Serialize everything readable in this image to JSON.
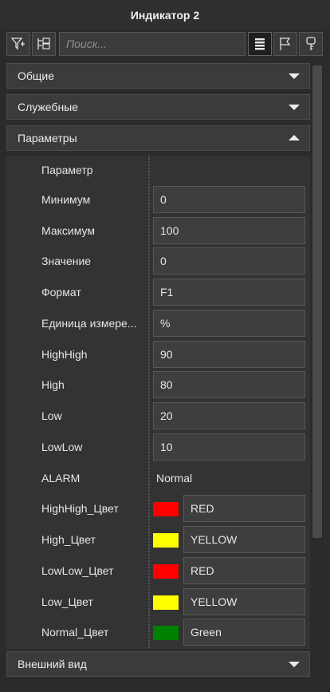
{
  "window": {
    "title": "Индикатор 2"
  },
  "toolbar": {
    "search_placeholder": "Поиск...",
    "buttons": [
      "filter-icon",
      "tree-icon",
      "list-view-icon",
      "flag-icon",
      "key-icon"
    ]
  },
  "sections": {
    "general": "Общие",
    "service": "Служебные",
    "params": "Параметры",
    "appearance": "Внешний вид"
  },
  "params": {
    "header": "Параметр",
    "rows": [
      {
        "label": "Минимум",
        "value": "0"
      },
      {
        "label": "Максимум",
        "value": "100"
      },
      {
        "label": "Значение",
        "value": "0"
      },
      {
        "label": "Формат",
        "value": "F1"
      },
      {
        "label": "Единица измере...",
        "value": "%"
      },
      {
        "label": "HighHigh",
        "value": "90"
      },
      {
        "label": "High",
        "value": "80"
      },
      {
        "label": "Low",
        "value": "20"
      },
      {
        "label": "LowLow",
        "value": "10"
      }
    ],
    "alarm": {
      "label": "ALARM",
      "value": "Normal"
    },
    "colors": [
      {
        "label": "HighHigh_Цвет",
        "value": "RED",
        "swatch": "#ff0000"
      },
      {
        "label": "High_Цвет",
        "value": "YELLOW",
        "swatch": "#ffff00"
      },
      {
        "label": "LowLow_Цвет",
        "value": "RED",
        "swatch": "#ff0000"
      },
      {
        "label": "Low_Цвет",
        "value": "YELLOW",
        "swatch": "#ffff00"
      },
      {
        "label": "Normal_Цвет",
        "value": "Green",
        "swatch": "#008000"
      }
    ]
  },
  "theme": {
    "background": "#2b2b2b",
    "field": "#3e3e3e",
    "text": "#e6e6e6"
  }
}
